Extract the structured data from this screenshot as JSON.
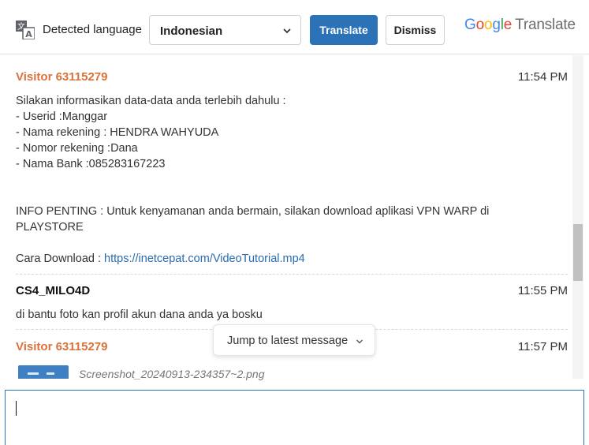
{
  "translate_bar": {
    "detected_label": "Detected language",
    "language": "Indonesian",
    "translate_label": "Translate",
    "dismiss_label": "Dismiss",
    "logo": {
      "brand": "Google",
      "product": "Translate"
    }
  },
  "messages": [
    {
      "sender": "Visitor 63115279",
      "time": "11:54 PM",
      "lines": [
        "Silakan informasikan data-data anda terlebih dahulu :",
        "- Userid :Manggar",
        "- Nama rekening : HENDRA WAHYUDA",
        "- Nomor rekening :Dana",
        "- Nama Bank :085283167223",
        "INFO PENTING : Untuk kenyamanan anda bermain, silakan download aplikasi VPN WARP di",
        "PLAYSTORE"
      ],
      "download_prefix": "Cara Download : ",
      "download_link": "https://inetcepat.com/VideoTutorial.mp4"
    },
    {
      "sender": "CS4_MILO4D",
      "time": "11:55 PM",
      "lines": [
        "di bantu foto kan profil akun dana anda ya bosku"
      ]
    },
    {
      "sender": "Visitor 63115279",
      "time": "11:57 PM",
      "attachment": "Screenshot_20240913-234357~2.png"
    }
  ],
  "jump_label": "Jump to latest message",
  "composer": {
    "value": ""
  },
  "colors": {
    "accent": "#2c72b6",
    "visitor": "#d8723a",
    "link": "#2a6bb0"
  }
}
